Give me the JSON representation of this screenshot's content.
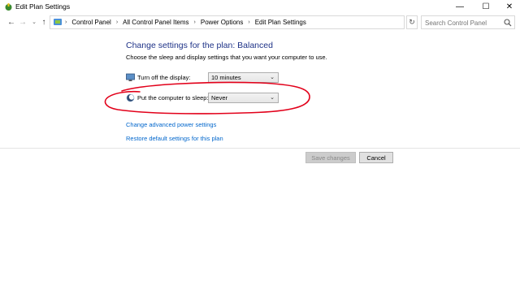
{
  "window": {
    "title": "Edit Plan Settings",
    "minimize_glyph": "—",
    "maximize_glyph": "☐",
    "close_glyph": "✕"
  },
  "nav": {
    "back_glyph": "←",
    "forward_glyph": "→",
    "history_glyph": "⌄",
    "up_glyph": "↑"
  },
  "address": {
    "crumbs": [
      "Control Panel",
      "All Control Panel Items",
      "Power Options",
      "Edit Plan Settings"
    ],
    "separator": "›",
    "dropdown_glyph": "⌄",
    "refresh_glyph": "↻"
  },
  "search": {
    "placeholder": "Search Control Panel"
  },
  "page": {
    "title": "Change settings for the plan: Balanced",
    "subtitle": "Choose the sleep and display settings that you want your computer to use."
  },
  "settings": {
    "display": {
      "label": "Turn off the display:",
      "value": "10 minutes"
    },
    "sleep": {
      "label": "Put the computer to sleep:",
      "value": "Never"
    },
    "chevron_glyph": "⌄"
  },
  "links": {
    "advanced": "Change advanced power settings",
    "restore": "Restore default settings for this plan"
  },
  "buttons": {
    "save": "Save changes",
    "cancel": "Cancel"
  },
  "colors": {
    "title_blue": "#1e3287",
    "link_blue": "#0066cc",
    "annotation_red": "#e2001a"
  }
}
